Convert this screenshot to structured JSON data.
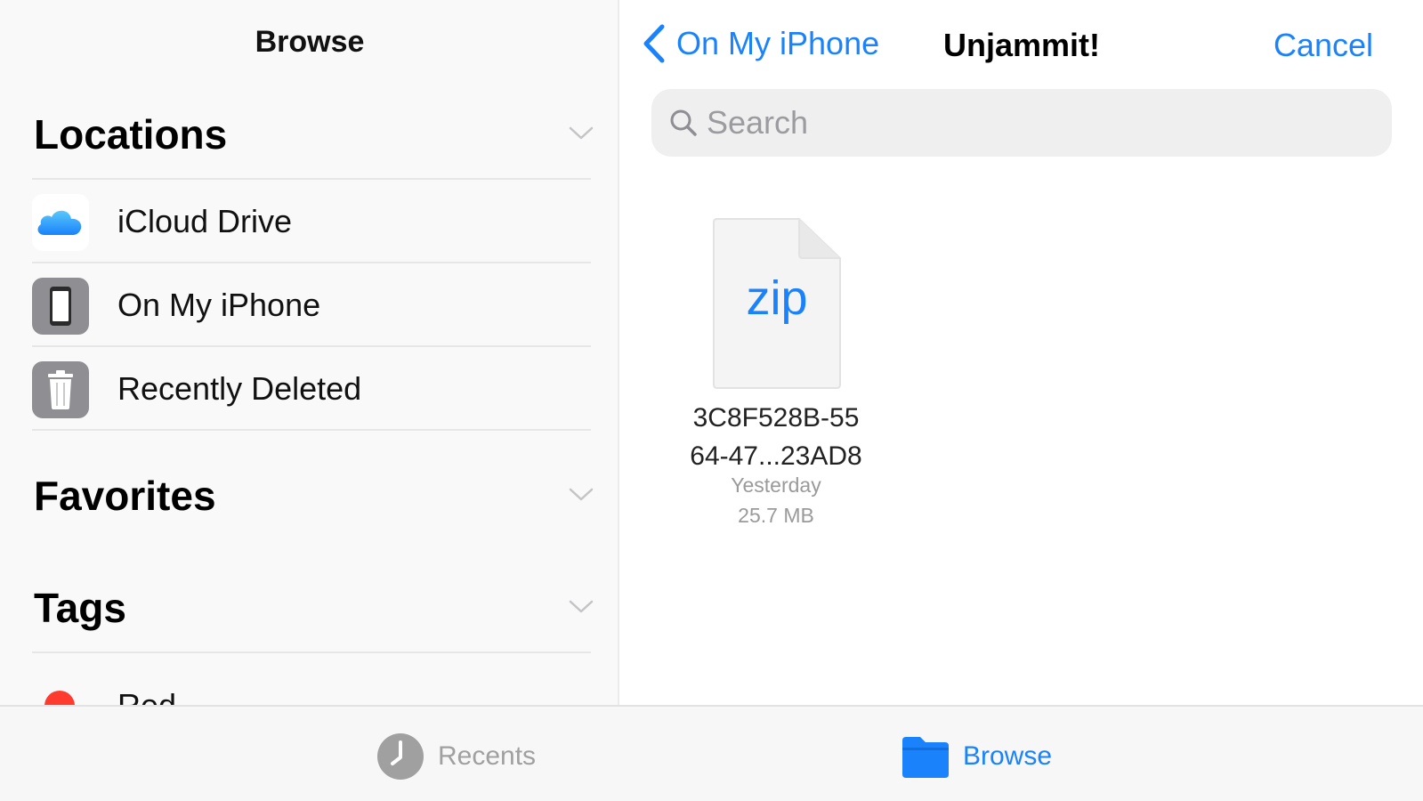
{
  "sidebar": {
    "title": "Browse",
    "sections": {
      "locations": {
        "title": "Locations"
      },
      "favorites": {
        "title": "Favorites"
      },
      "tags": {
        "title": "Tags"
      }
    },
    "locations": [
      {
        "label": "iCloud Drive",
        "icon": "icloud-icon"
      },
      {
        "label": "On My iPhone",
        "icon": "iphone-icon"
      },
      {
        "label": "Recently Deleted",
        "icon": "trash-icon"
      }
    ],
    "tags": [
      {
        "label": "Red",
        "color": "#ff3b30"
      }
    ]
  },
  "main": {
    "back_label": "On My iPhone",
    "title": "Unjammit!",
    "cancel_label": "Cancel",
    "search": {
      "placeholder": "Search",
      "value": ""
    },
    "files": [
      {
        "ext": "zip",
        "name_line1": "3C8F528B-55",
        "name_line2": "64-47...23AD8",
        "date": "Yesterday",
        "size": "25.7 MB"
      }
    ]
  },
  "tabbar": {
    "recents_label": "Recents",
    "browse_label": "Browse",
    "active_tab": "browse"
  },
  "colors": {
    "accent": "#1a82fb",
    "tag_red": "#ff3b30",
    "icon_gray": "#8e8e93"
  }
}
